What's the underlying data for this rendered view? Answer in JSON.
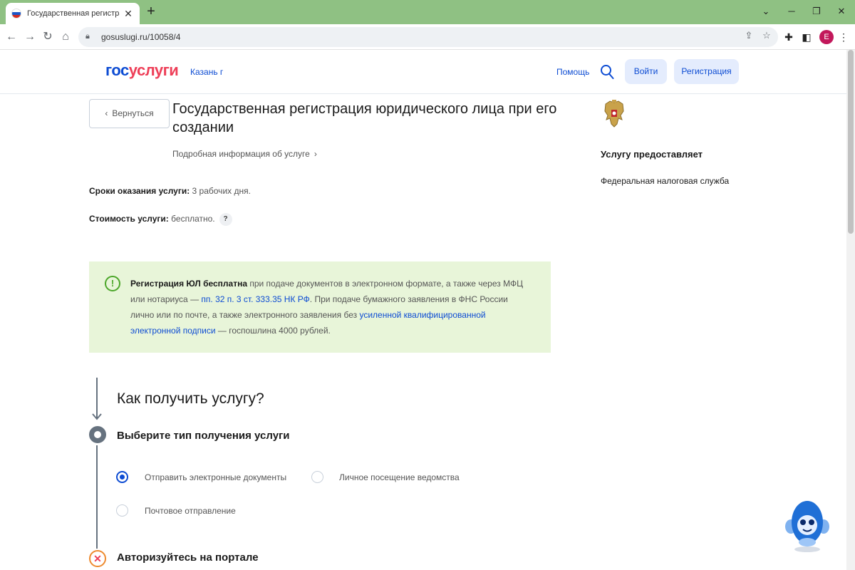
{
  "browser": {
    "tab_title": "Государственная регистрация юр",
    "url": "gosuslugi.ru/10058/4",
    "profile_letter": "E"
  },
  "header": {
    "logo_part1": "гос",
    "logo_part2": "услуги",
    "city": "Казань г",
    "help": "Помощь",
    "login": "Войти",
    "register": "Регистрация"
  },
  "main": {
    "back": "Вернуться",
    "title": "Государственная регистрация юридического лица при его создании",
    "more_info": "Подробная информация об услуге",
    "term_label": "Сроки оказания услуги:",
    "term_value": "3 рабочих дня.",
    "cost_label": "Стоимость услуги:",
    "cost_value": "бесплатно.",
    "cost_help": "?"
  },
  "notice": {
    "bold": "Регистрация ЮЛ бесплатна",
    "text1": " при подаче документов в электронном формате, а также через МФЦ или нотариуса — ",
    "link1": "пп. 32 п. 3 ст. 333.35 НК РФ",
    "text2": ". При подаче бумажного заявления в ФНС России лично или по почте, а также электронного заявления без ",
    "link2": "усиленной квалифицированной электронной подписи",
    "text3": " — госпошлина 4000 рублей."
  },
  "how": {
    "title": "Как получить услугу?",
    "step1_title": "Выберите тип получения услуги",
    "options": [
      {
        "label": "Отправить электронные документы",
        "selected": true
      },
      {
        "label": "Личное посещение ведомства",
        "selected": false
      },
      {
        "label": "Почтовое отправление",
        "selected": false
      }
    ],
    "step2_title": "Авторизуйтесь на портале"
  },
  "provider": {
    "title": "Услугу предоставляет",
    "name": "Федеральная налоговая служба"
  },
  "colors": {
    "brand_blue": "#0d4cd3",
    "brand_red": "#ee3f58",
    "notice_bg": "#e8f5d9",
    "tab_bar": "#8fc183"
  }
}
